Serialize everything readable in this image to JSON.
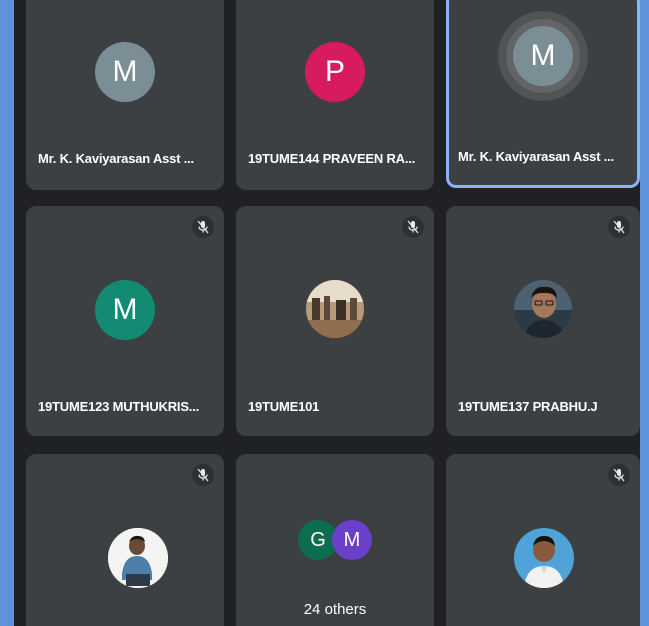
{
  "colors": {
    "background": "#202124",
    "tile": "#3c4043",
    "active_border": "#8ab4f8",
    "avatar_grey": "#7b8e95",
    "avatar_pink": "#d81b60",
    "avatar_teal": "#138a72",
    "avatar_green_g": "#0d6e4f",
    "avatar_purple_m": "#6a3fc9"
  },
  "tiles": [
    {
      "name": "Mr. K. Kaviyarasan Asst ...",
      "avatar_letter": "M",
      "avatar_type": "letter",
      "muted": false,
      "active": false
    },
    {
      "name": "19TUME144 PRAVEEN RA...",
      "avatar_letter": "P",
      "avatar_type": "letter",
      "muted": false,
      "active": false
    },
    {
      "name": "Mr. K. Kaviyarasan Asst ...",
      "avatar_letter": "M",
      "avatar_type": "letter",
      "muted": false,
      "active": true,
      "speaking": true
    },
    {
      "name": "19TUME123 MUTHUKRIS...",
      "avatar_letter": "M",
      "avatar_type": "letter",
      "muted": true,
      "active": false
    },
    {
      "name": "19TUME101",
      "avatar_type": "photo",
      "muted": true,
      "active": false
    },
    {
      "name": "19TUME137 PRABHU.J",
      "avatar_type": "photo",
      "muted": true,
      "active": false
    },
    {
      "name": "",
      "avatar_type": "photo",
      "muted": true,
      "active": false
    },
    {
      "others_label": "24 others",
      "avatar_letters": [
        "G",
        "M"
      ],
      "avatar_type": "group",
      "muted": false,
      "active": false
    },
    {
      "name": "",
      "avatar_type": "photo",
      "muted": true,
      "active": false
    }
  ]
}
